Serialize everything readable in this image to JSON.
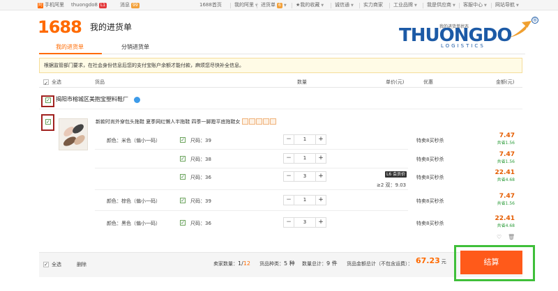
{
  "topbar": {
    "mobile": "手机阿里",
    "username": "thuongdo8",
    "user_badge": "L1",
    "messages": "消息",
    "messages_badge": "99",
    "home": "1688首页",
    "my_ali": "我的阿里",
    "purchase_list": "进货单",
    "purchase_badge": "6",
    "favorites": "我的收藏",
    "trust": "诚信通",
    "power_merchant": "实力商家",
    "industrial": "工业品牌",
    "supplier": "我是供应商",
    "service": "客服中心",
    "site_nav": "网站导航"
  },
  "header": {
    "logo": "1688",
    "title": "我的进货单",
    "tab_active": "我的进货单",
    "tab_other": "分销进货单"
  },
  "watermark": {
    "small": "我的进货单状态",
    "brand": "THUONGDO",
    "sub": "LOGISTICS",
    "reg": "®"
  },
  "notice": "根据监管部门要求，在社会身份信息后您的支付宝账户余额才能付款，麻烦您尽快补全信息。",
  "table_header": {
    "select_all": "全选",
    "product": "货品",
    "quantity": "数量",
    "unit_price": "单价(元)",
    "discount": "优惠",
    "amount": "金额(元)"
  },
  "shop": {
    "name": "揭阳市榕城区美抱宝塑料鞋厂"
  },
  "product": {
    "title": "新款时尚外穿包头拖鞋 夏季网红懒人半拖鞋 四季一脚蹬平底拖鞋女"
  },
  "rows": [
    {
      "color": "颜色：米色（偏小一码）",
      "size": "尺码：39",
      "qty": "1",
      "promo": "特卖8买秒杀",
      "amount": "7.47",
      "save_prefix": "共省",
      "save": "1.56"
    },
    {
      "color": "",
      "size": "尺码：38",
      "qty": "1",
      "promo": "特卖8买秒杀",
      "amount": "7.47",
      "save_prefix": "共省",
      "save": "1.56"
    },
    {
      "color": "",
      "size": "尺码：36",
      "qty": "3",
      "promo": "特卖8买秒杀",
      "amount": "22.41",
      "save_prefix": "共省",
      "save": "4.68"
    },
    {
      "color": "颜色：棕色（偏小一码）",
      "size": "尺码：39",
      "qty": "1",
      "promo": "特卖8买秒杀",
      "amount": "7.47",
      "save_prefix": "共省",
      "save": "1.56"
    },
    {
      "color": "颜色：黑色（偏小一码）",
      "size": "尺码：36",
      "qty": "3",
      "promo": "特卖8买秒杀",
      "amount": "22.41",
      "save_prefix": "共省",
      "save": "4.68"
    }
  ],
  "price_tier": {
    "badge": "L6 会员价",
    "text": "≥2 双：9.03"
  },
  "footer": {
    "select_all": "全选",
    "delete": "删除",
    "sellers_label": "卖家数量：",
    "sellers_selected": "1",
    "sellers_sep": "/",
    "sellers_total": "12",
    "kinds_label": "货品种类：",
    "kinds": "5 种",
    "qty_label": "数量总计：",
    "qty": "9 件",
    "total_label": "货品金额总计（不包含运费）：",
    "total": "67.23",
    "total_unit": "元",
    "checkout": "结算"
  },
  "colors": {
    "accent": "#ff6a00",
    "checkout": "#ff5a1a",
    "highlight_green": "#3fbf3a",
    "highlight_red": "#a0211e"
  }
}
